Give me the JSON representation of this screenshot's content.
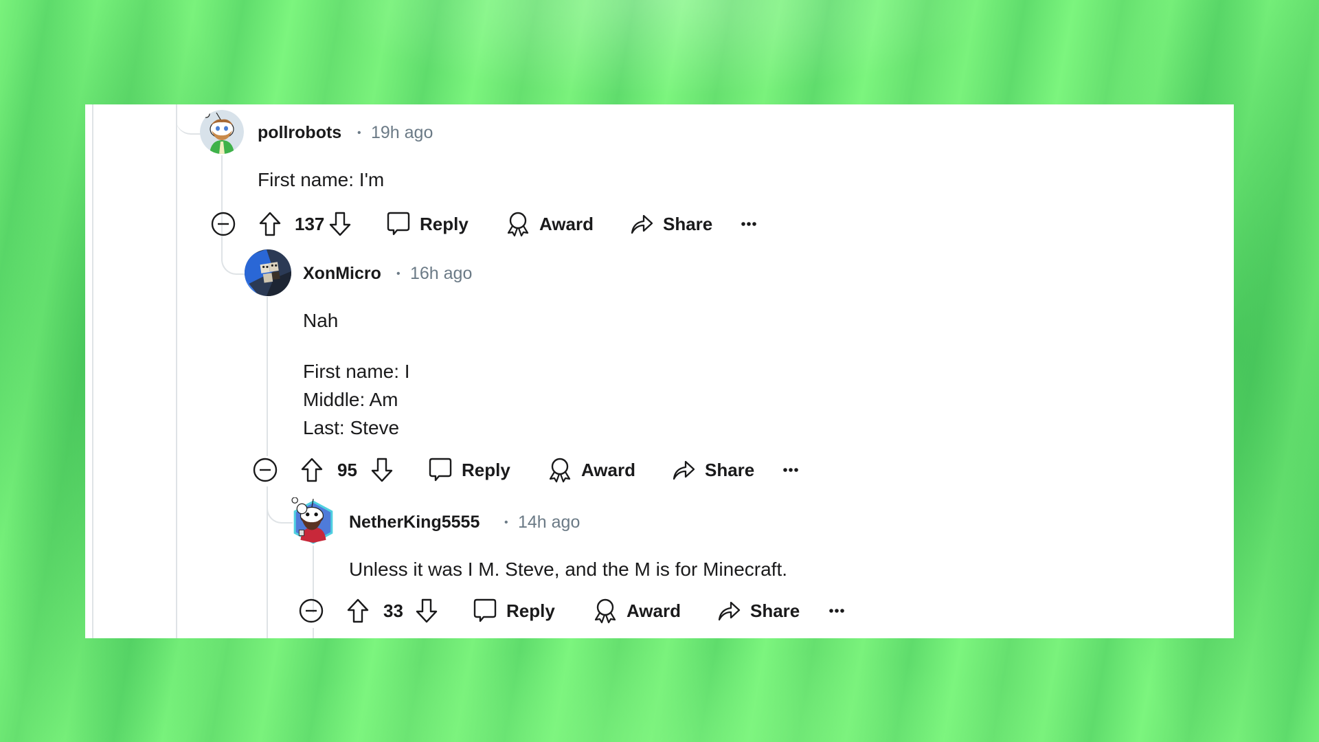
{
  "colors": {
    "background": "#6ee775",
    "card": "#ffffff",
    "text": "#1a1a1b",
    "meta": "#6b7a86",
    "thread_line": "#dfe3e6"
  },
  "comments": [
    {
      "username": "pollrobots",
      "time": "19h ago",
      "separator": "•",
      "avatar": "snoo-avatar-beard-green-hoodie",
      "body": [
        "First name: I'm"
      ],
      "votes": "137",
      "actions": {
        "collapse_icon": "collapse-icon",
        "upvote_icon": "upvote-icon",
        "downvote_icon": "downvote-icon",
        "reply": "Reply",
        "award": "Award",
        "share": "Share",
        "more": "⋯"
      }
    },
    {
      "username": "XonMicro",
      "time": "16h ago",
      "separator": "•",
      "avatar": "photo-avatar-keycaps",
      "body": [
        "Nah",
        "",
        "First name: I",
        "Middle: Am",
        "Last: Steve"
      ],
      "votes": "95",
      "actions": {
        "collapse_icon": "collapse-icon",
        "upvote_icon": "upvote-icon",
        "downvote_icon": "downvote-icon",
        "reply": "Reply",
        "award": "Award",
        "share": "Share",
        "more": "⋯"
      }
    },
    {
      "username": "NetherKing5555",
      "time": "14h ago",
      "separator": "•",
      "avatar": "snoo-avatar-beard-red-hexagon",
      "body": [
        "Unless it was I M. Steve, and the M is for Minecraft."
      ],
      "votes": "33",
      "actions": {
        "collapse_icon": "collapse-icon",
        "upvote_icon": "upvote-icon",
        "downvote_icon": "downvote-icon",
        "reply": "Reply",
        "award": "Award",
        "share": "Share",
        "more": "⋯"
      }
    }
  ]
}
